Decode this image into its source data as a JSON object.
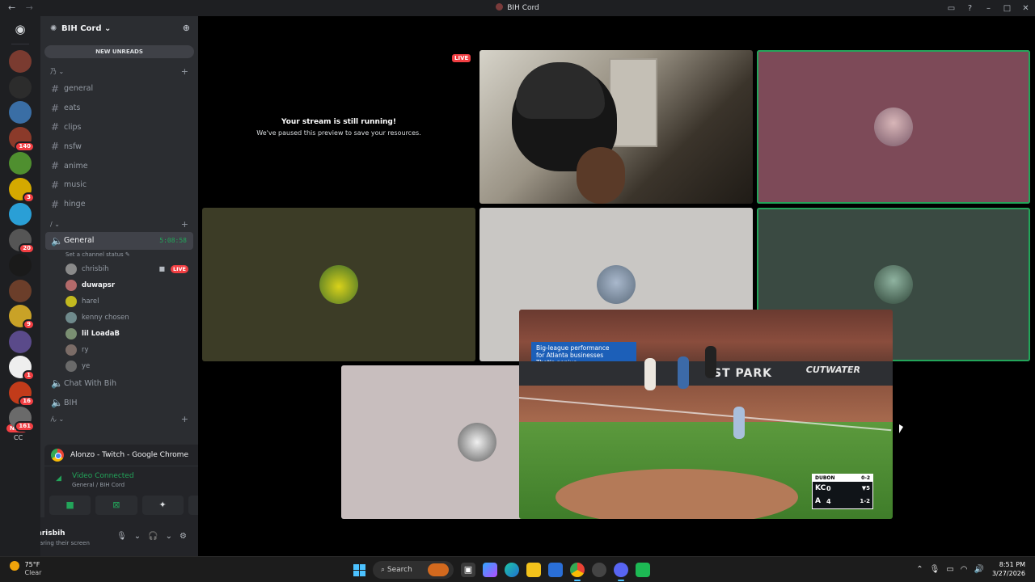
{
  "window": {
    "title": "BIH Cord",
    "nav_back": "←",
    "nav_forward": "→"
  },
  "server": {
    "name": "BIH Cord",
    "new_unreads_label": "NEW UNREADS",
    "categories": [
      {
        "label": "乃",
        "channels": [
          "general",
          "eats",
          "clips",
          "nsfw",
          "anime",
          "music",
          "hinge"
        ]
      },
      {
        "label": "/"
      }
    ],
    "voice_channel": {
      "name": "General",
      "timer": "5:08:58",
      "status_placeholder": "Set a channel status",
      "users": [
        {
          "name": "chrisbih",
          "live": "LIVE",
          "camera": true,
          "bold": false,
          "color": "#8a8a8a"
        },
        {
          "name": "duwapsr",
          "bold": true,
          "color": "#b36a6a"
        },
        {
          "name": "harel",
          "bold": false,
          "color": "#c2b91f"
        },
        {
          "name": "kenny chosen",
          "bold": false,
          "color": "#6f8a8c"
        },
        {
          "name": "lil LoadaB",
          "bold": true,
          "color": "#7a8f72"
        },
        {
          "name": "ry",
          "bold": false,
          "color": "#7b6c67"
        },
        {
          "name": "ye",
          "bold": false,
          "color": "#6a6a6a"
        }
      ]
    },
    "other_voice_channels": [
      "Chat With Bih",
      "BIH"
    ],
    "bottom_category": "ん"
  },
  "guilds": [
    {
      "color": "#7a3b30",
      "badge": ""
    },
    {
      "color": "#2c2c2c",
      "badge": ""
    },
    {
      "color": "#3a6ea5",
      "badge": ""
    },
    {
      "color": "#8b3a2a",
      "badge": "140"
    },
    {
      "color": "#4f8f2f",
      "badge": ""
    },
    {
      "color": "#d4a900",
      "badge": "3"
    },
    {
      "color": "#2a9fd6",
      "badge": ""
    },
    {
      "color": "#555555",
      "badge": "20"
    },
    {
      "color": "#1a1a1a",
      "badge": ""
    },
    {
      "color": "#6b3e2a",
      "badge": ""
    },
    {
      "color": "#c9a227",
      "badge": "9"
    },
    {
      "color": "#5a4a8a",
      "badge": ""
    },
    {
      "color": "#eeeeee",
      "badge": "1"
    },
    {
      "color": "#c23b1a",
      "badge": "16"
    },
    {
      "color": "#6a6a6a",
      "badge": "161"
    }
  ],
  "guild_new_badge": "NEW",
  "guild_bottom_text": "CC",
  "connection_panel": {
    "stream_source": "Alonzo - Twitch - Google Chrome",
    "status": "Video Connected",
    "location": "General / BIH Cord"
  },
  "user": {
    "name": "chrisbih",
    "status": "Sharing their screen"
  },
  "stage": {
    "live_tag": "LIVE",
    "paused_heading": "Your stream is still running!",
    "paused_message": "We've paused this preview to save your resources.",
    "tile_colors": {
      "pink": "#7d4a58",
      "olive": "#3c3c26",
      "lightgray": "#c9c7c4",
      "darkgreen": "#3a4a42",
      "mauve": "#c8bebe"
    }
  },
  "broadcast": {
    "ad_line1": "Big-league performance",
    "ad_line2": "for Atlanta businesses",
    "ad_line3": "That's genius.",
    "park_sign": "ST PARK",
    "sponsor": "CUTWATER",
    "scoreboard": {
      "header_left": "DUBON",
      "header_right": "0-2",
      "team1": "KC",
      "team1_runs": "0",
      "inning": "▼5",
      "team2": "A",
      "team2_runs": "4",
      "count": "1-2"
    }
  },
  "taskbar": {
    "temperature": "75°F",
    "condition": "Clear",
    "search_label": "Search",
    "time": "8:51 PM",
    "date": "3/27/2026"
  }
}
